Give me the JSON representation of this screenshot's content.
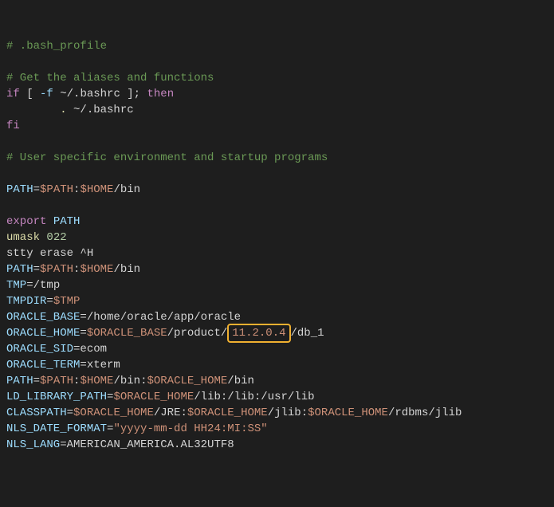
{
  "c1": "# .bash_profile",
  "c2": "# Get the aliases and functions",
  "kw_if": "if",
  "br1": " [ ",
  "flag_f": "-f",
  "path_bashrc": " ~/.bashrc ",
  "br2": "]; ",
  "kw_then": "then",
  "indent_dot": "        .",
  "path_bashrc2": " ~/.bashrc",
  "kw_fi": "fi",
  "c3": "# User specific environment and startup programs",
  "v_PATH": "PATH",
  "eq": "=",
  "s_PATH": "$PATH",
  "colon": ":",
  "s_HOME": "$HOME",
  "p_bin": "/bin",
  "kw_export": "export",
  "sp": " ",
  "fn_umask": "umask",
  "n_022": " 022",
  "stty": "stty erase ^H",
  "v_TMP": "TMP",
  "p_tmp": "/tmp",
  "v_TMPDIR": "TMPDIR",
  "s_TMP": "$TMP",
  "v_OB": "ORACLE_BASE",
  "p_ob": "/home/oracle/app/oracle",
  "v_OH": "ORACLE_HOME",
  "s_OB": "$ORACLE_BASE",
  "p_prod": "/product/",
  "ver": "11.2.0.4",
  "p_db1": "/db_1",
  "v_OSID": "ORACLE_SID",
  "p_ecom": "ecom",
  "v_OTERM": "ORACLE_TERM",
  "p_xterm": "xterm",
  "s_OH": "$ORACLE_HOME",
  "v_LDLP": "LD_LIBRARY_PATH",
  "p_lib": "/lib:/lib:/usr/lib",
  "v_CP": "CLASSPATH",
  "p_jre": "/JRE:",
  "p_jlib": "/jlib:",
  "p_rjlib": "/rdbms/jlib",
  "v_NDF": "NLS_DATE_FORMAT",
  "s_dfmt": "\"yyyy-mm-dd HH24:MI:SS\"",
  "v_NL": "NLS_LANG",
  "p_nls": "AMERICAN_AMERICA.AL32UTF8"
}
